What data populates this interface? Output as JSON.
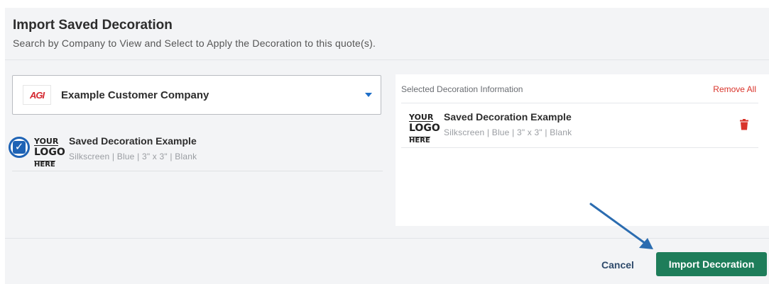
{
  "modal": {
    "title": "Import Saved Decoration",
    "subtitle": "Search by Company to View and Select to Apply the Decoration to this quote(s)."
  },
  "company_select": {
    "logo_text": "AGI",
    "selected_value": "Example Customer Company"
  },
  "logo_placeholder": {
    "line1": "YOUR",
    "line2": "LOGO",
    "line3": "HERE"
  },
  "decoration_list": [
    {
      "name": "Saved Decoration Example",
      "meta": "Silkscreen | Blue | 3\" x 3\" | Blank",
      "checked": true
    }
  ],
  "selected_panel": {
    "heading": "Selected Decoration Information",
    "remove_all_label": "Remove All",
    "items": [
      {
        "name": "Saved Decoration Example",
        "meta": "Silkscreen | Blue | 3\" x 3\" | Blank"
      }
    ]
  },
  "footer": {
    "cancel_label": "Cancel",
    "import_label": "Import Decoration"
  },
  "colors": {
    "accent_blue": "#1e63b5",
    "primary_green": "#1e7d5a",
    "danger_red": "#d9342b",
    "annotation_arrow": "#2b6cb0"
  },
  "icons": [
    "chevron-down-icon",
    "checkbox-checked-icon",
    "trash-icon",
    "annotation-arrow-icon"
  ]
}
